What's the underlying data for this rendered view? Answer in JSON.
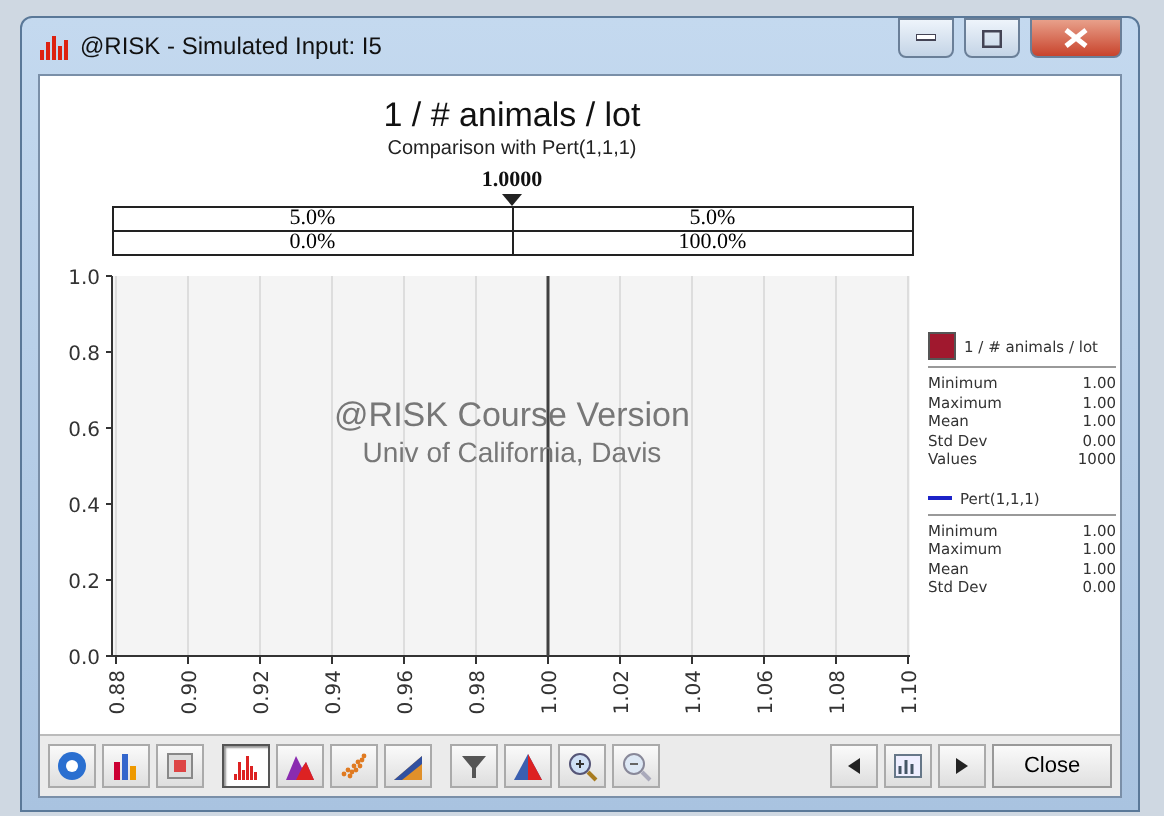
{
  "window": {
    "title": "@RISK - Simulated Input: I5"
  },
  "chart": {
    "title": "1 / # animals / lot",
    "subtitle": "Comparison with Pert(1,1,1)",
    "delimiter": "1.0000",
    "probabilities": [
      [
        "5.0%",
        "5.0%"
      ],
      [
        "0.0%",
        "100.0%"
      ]
    ],
    "watermark": [
      "@RISK Course Version",
      "Univ of California, Davis"
    ],
    "chart_data": {
      "type": "line",
      "x": [
        1.0,
        1.0
      ],
      "grid": true,
      "series": [
        {
          "color": "#404040",
          "values": [
            0,
            1
          ]
        }
      ],
      "xlim": [
        0.88,
        1.1
      ],
      "ylim": [
        0,
        1
      ],
      "xticks": [
        {
          "value": 0.88,
          "label": "0.88"
        },
        {
          "value": 0.9,
          "label": "0.90"
        },
        {
          "value": 0.92,
          "label": "0.92"
        },
        {
          "value": 0.94,
          "label": "0.94"
        },
        {
          "value": 0.96,
          "label": "0.96"
        },
        {
          "value": 0.98,
          "label": "0.98"
        },
        {
          "value": 1.0,
          "label": "1.00"
        },
        {
          "value": 1.02,
          "label": "1.02"
        },
        {
          "value": 1.04,
          "label": "1.04"
        },
        {
          "value": 1.06,
          "label": "1.06"
        },
        {
          "value": 1.08,
          "label": "1.08"
        },
        {
          "value": 1.1,
          "label": "1.10"
        }
      ],
      "yticks": [
        {
          "value": 0,
          "label": "0.0"
        },
        {
          "value": 0.2,
          "label": "0.2"
        },
        {
          "value": 0.4,
          "label": "0.4"
        },
        {
          "value": 0.6,
          "label": "0.6"
        },
        {
          "value": 0.8,
          "label": "0.8"
        },
        {
          "value": 1,
          "label": "1.0"
        }
      ]
    }
  },
  "legend": [
    {
      "kind": "swatch",
      "color": "#a0182e",
      "name": "1 / # animals / lot",
      "stats": [
        [
          "Minimum",
          "1.00"
        ],
        [
          "Maximum",
          "1.00"
        ],
        [
          "Mean",
          "1.00"
        ],
        [
          "Std Dev",
          "0.00"
        ],
        [
          "Values",
          "1000"
        ]
      ]
    },
    {
      "kind": "line",
      "color": "#1c22c8",
      "name": "Pert(1,1,1)",
      "stats": [
        [
          "Minimum",
          "1.00"
        ],
        [
          "Maximum",
          "1.00"
        ],
        [
          "Mean",
          "1.00"
        ],
        [
          "Std Dev",
          "0.00"
        ]
      ]
    }
  ],
  "toolbar": {
    "buttons": [
      {
        "kind": "help",
        "selected": false
      },
      {
        "kind": "bars",
        "selected": false
      },
      {
        "kind": "report",
        "selected": false
      },
      {
        "kind": "histogram",
        "selected": true
      },
      {
        "kind": "mountain",
        "selected": false
      },
      {
        "kind": "scatter",
        "selected": false
      },
      {
        "kind": "cumulative",
        "selected": false
      },
      {
        "kind": "filter",
        "selected": false
      },
      {
        "kind": "fit",
        "selected": false
      },
      {
        "kind": "zoom-in",
        "selected": false
      },
      {
        "kind": "zoom-out",
        "selected": false
      }
    ],
    "close": "Close"
  }
}
